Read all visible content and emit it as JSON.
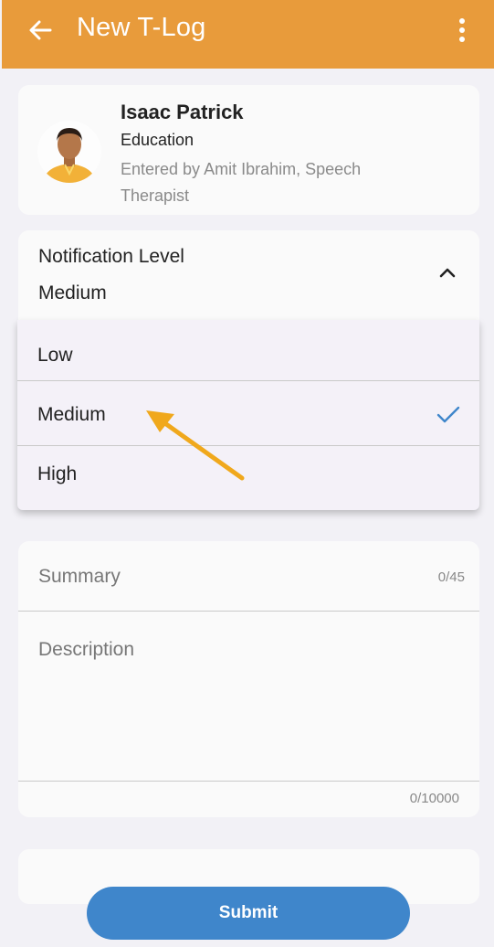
{
  "app_bar": {
    "title": "New T-Log",
    "back_icon": "arrow-left-icon",
    "menu_icon": "more-vertical-icon",
    "color": "#e89b3b"
  },
  "student": {
    "name": "Isaac Patrick",
    "department": "Education",
    "entered_by": "Entered by Amit Ibrahim, Speech Therapist"
  },
  "notification": {
    "label": "Notification Level",
    "selected": "Medium",
    "chevron_icon": "chevron-up-icon",
    "options": [
      {
        "label": "Low",
        "selected": false
      },
      {
        "label": "Medium",
        "selected": true
      },
      {
        "label": "High",
        "selected": false
      }
    ]
  },
  "form": {
    "summary_placeholder": "Summary",
    "summary_counter": "0/45",
    "description_placeholder": "Description",
    "description_counter": "0/10000"
  },
  "actions": {
    "submit_label": "Submit",
    "submit_color": "#3f86cb"
  },
  "annotation": {
    "arrow_color": "#f0a81c"
  }
}
